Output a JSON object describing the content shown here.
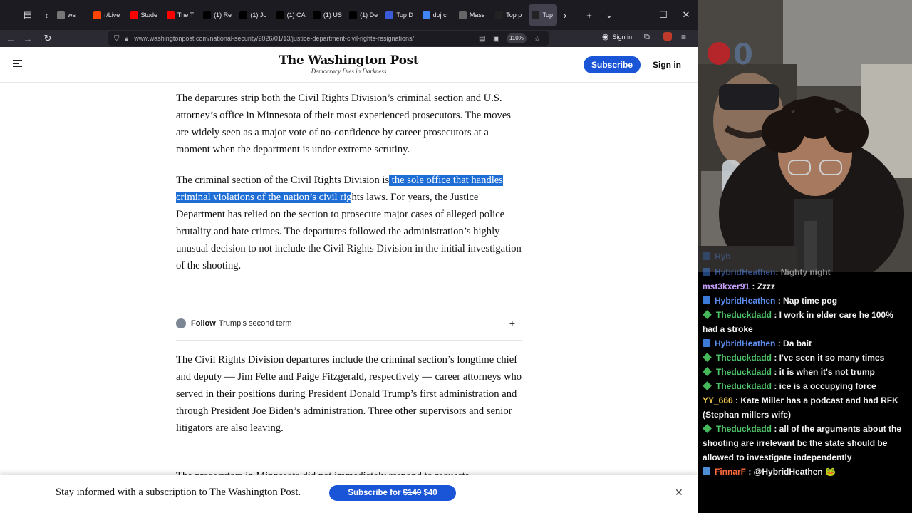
{
  "browser": {
    "tabs": [
      {
        "label": "ws",
        "icon": "page-icon",
        "color": "#777777"
      },
      {
        "label": "r/Live",
        "icon": "reddit-icon",
        "color": "#ff4500"
      },
      {
        "label": "Stude",
        "icon": "youtube-icon",
        "color": "#ff0000"
      },
      {
        "label": "The T",
        "icon": "youtube-icon",
        "color": "#ff0000"
      },
      {
        "label": "(1) Re",
        "icon": "x-icon",
        "color": "#000000"
      },
      {
        "label": "(1) Jo",
        "icon": "x-icon",
        "color": "#000000"
      },
      {
        "label": "(1) CA",
        "icon": "x-icon",
        "color": "#000000"
      },
      {
        "label": "(1) US",
        "icon": "x-icon",
        "color": "#000000"
      },
      {
        "label": "(1) De",
        "icon": "x-icon",
        "color": "#000000"
      },
      {
        "label": "Top D",
        "icon": "wapo-icon",
        "color": "#3b5bdb"
      },
      {
        "label": "doj ci",
        "icon": "google-icon",
        "color": "#4285f4"
      },
      {
        "label": "Mass",
        "icon": "globe-icon",
        "color": "#666666"
      },
      {
        "label": "Top p",
        "icon": "wapo-icon",
        "color": "#222222"
      },
      {
        "label": "Top",
        "icon": "wapo-icon",
        "color": "#222222",
        "active": true
      }
    ],
    "url": "www.washingtonpost.com/national-security/2026/01/13/justice-department-civil-rights-resignations/",
    "zoom": "110%",
    "account_label": "Sign in"
  },
  "wapo": {
    "logo_name": "The Washington Post",
    "tagline": "Democracy Dies in Darkness",
    "subscribe_label": "Subscribe",
    "signin_label": "Sign in",
    "para1": "The departures strip both the Civil Rights Division’s criminal section and U.S. attorney’s office in Minnesota of their most experienced prosecutors. The moves are widely seen as a major vote of no-confidence by career prosecutors at a moment when the department is under extreme scrutiny.",
    "para2_pre": "The criminal section of the Civil Rights Division is",
    "para2_highlight": " the sole office that handles criminal violations of the nation’s civil rig",
    "para2_post": "hts laws. For years, the Justice Department has relied on the section to prosecute major cases of alleged police brutality and hate crimes. The departures followed the administration’s highly unusual decision to not include the Civil Rights Division in the initial investigation of the shooting.",
    "follow_word": "Follow",
    "follow_topic": "Trump’s second term",
    "para3": "The Civil Rights Division departures include the criminal section’s longtime chief and deputy — Jim Felte and Paige Fitzgerald, respectively — career attorneys who served in their positions during President Donald Trump’s first administration and through President Joe Biden’s administration. Three other supervisors and senior litigators are also leaving.",
    "para4_cut": "The prosecutors in Minnesota did not immediately respond to requests",
    "subbar_message": "Stay informed with a subscription to The Washington Post.",
    "subbar_cta_prefix": "Subscribe for ",
    "subbar_cta_old": "$140",
    "subbar_cta_new": " $40"
  },
  "stream": {
    "overlay_counter": "0",
    "chat": [
      {
        "user": "Hyb",
        "text": "",
        "badge": "square",
        "color": "#5b8def",
        "partial": true
      },
      {
        "user": "HybridHeathen",
        "text": ": Nighty night",
        "badge": "square",
        "color": "#5b8def",
        "partial": true
      },
      {
        "user": "mst3kxer91",
        "text": " : Zzzz",
        "badge": "none",
        "color": "#c9a0ff"
      },
      {
        "user": "HybridHeathen",
        "text": " : Nap time pog",
        "badge": "square",
        "color": "#5b8def"
      },
      {
        "user": "Theduckdadd",
        "text": " : I work in elder care he 100% had a stroke",
        "badge": "diamond",
        "color": "#4ec56a"
      },
      {
        "user": "HybridHeathen",
        "text": " : Da bait",
        "badge": "square",
        "color": "#5b8def"
      },
      {
        "user": "Theduckdadd",
        "text": " : I've seen it so many times",
        "badge": "diamond",
        "color": "#4ec56a"
      },
      {
        "user": "Theduckdadd",
        "text": " : it is when it's not trump",
        "badge": "diamond",
        "color": "#4ec56a"
      },
      {
        "user": "Theduckdadd",
        "text": " : ice is a occupying force",
        "badge": "diamond",
        "color": "#4ec56a"
      },
      {
        "user": "YY_666",
        "text": " : Kate Miller has a podcast and had RFK (Stephan millers wife)",
        "badge": "none",
        "color": "#f2c94c"
      },
      {
        "user": "Theduckdadd",
        "text": " : all of the arguments about the shooting are irrelevant bc the state should be allowed to investigate independently",
        "badge": "diamond",
        "color": "#4ec56a"
      },
      {
        "user": "FinnarF",
        "text": " : @HybridHeathen 🐸",
        "badge": "bits",
        "color": "#ff6a3d"
      }
    ]
  }
}
